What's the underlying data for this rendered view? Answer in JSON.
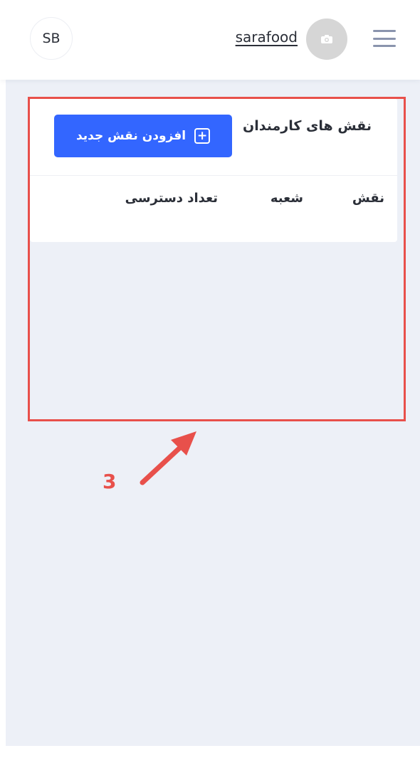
{
  "header": {
    "avatar_initials": "SB",
    "store_name": "sarafood",
    "store_logo_icon": "camera-icon",
    "menu_icon": "hamburger-icon"
  },
  "card": {
    "title": "نقش های کارمندان",
    "add_button_label": "افزودن نقش جدید",
    "add_button_icon": "plus-square-icon",
    "columns": [
      "نقش",
      "شعبه",
      "تعداد دسترسی"
    ]
  },
  "annotation": {
    "step_number": "3"
  },
  "colors": {
    "primary": "#3366ff",
    "annotation": "#e8504b",
    "background": "#edf0f7"
  }
}
